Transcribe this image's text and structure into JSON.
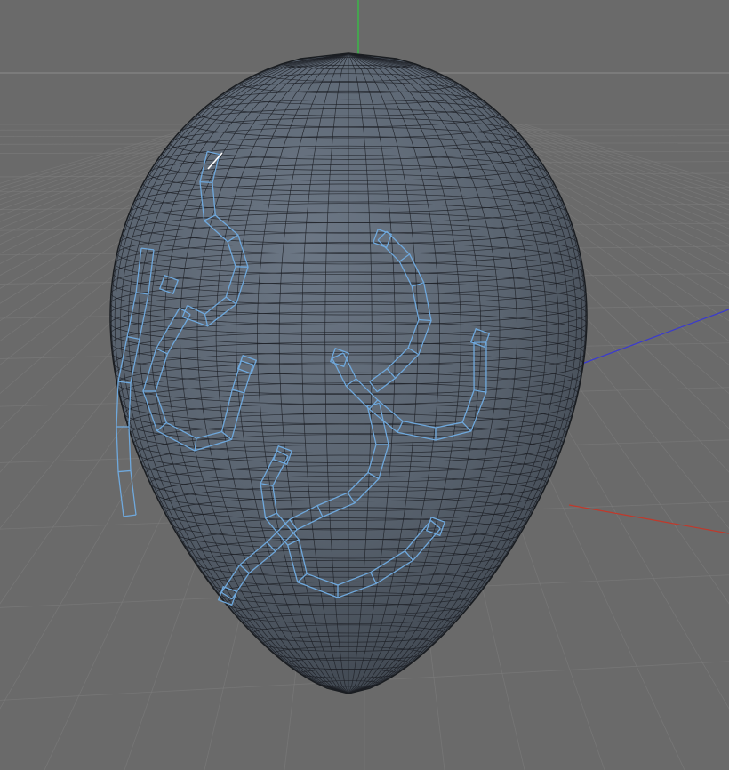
{
  "viewport": {
    "background_color": "#6b6b6b",
    "grid_color": "#7e7e7e",
    "horizon_color": "#8c8c8c"
  },
  "axes": {
    "x_color": "#c0392b",
    "y_color": "#2ecc40",
    "z_color": "#3a3ad0"
  },
  "object": {
    "type": "egg",
    "surface_color": "#5a6470",
    "wire_color": "#1c1f24"
  },
  "selection": {
    "edge_loop_color": "#6fa8dc",
    "active_edge_color": "#ffffff"
  }
}
